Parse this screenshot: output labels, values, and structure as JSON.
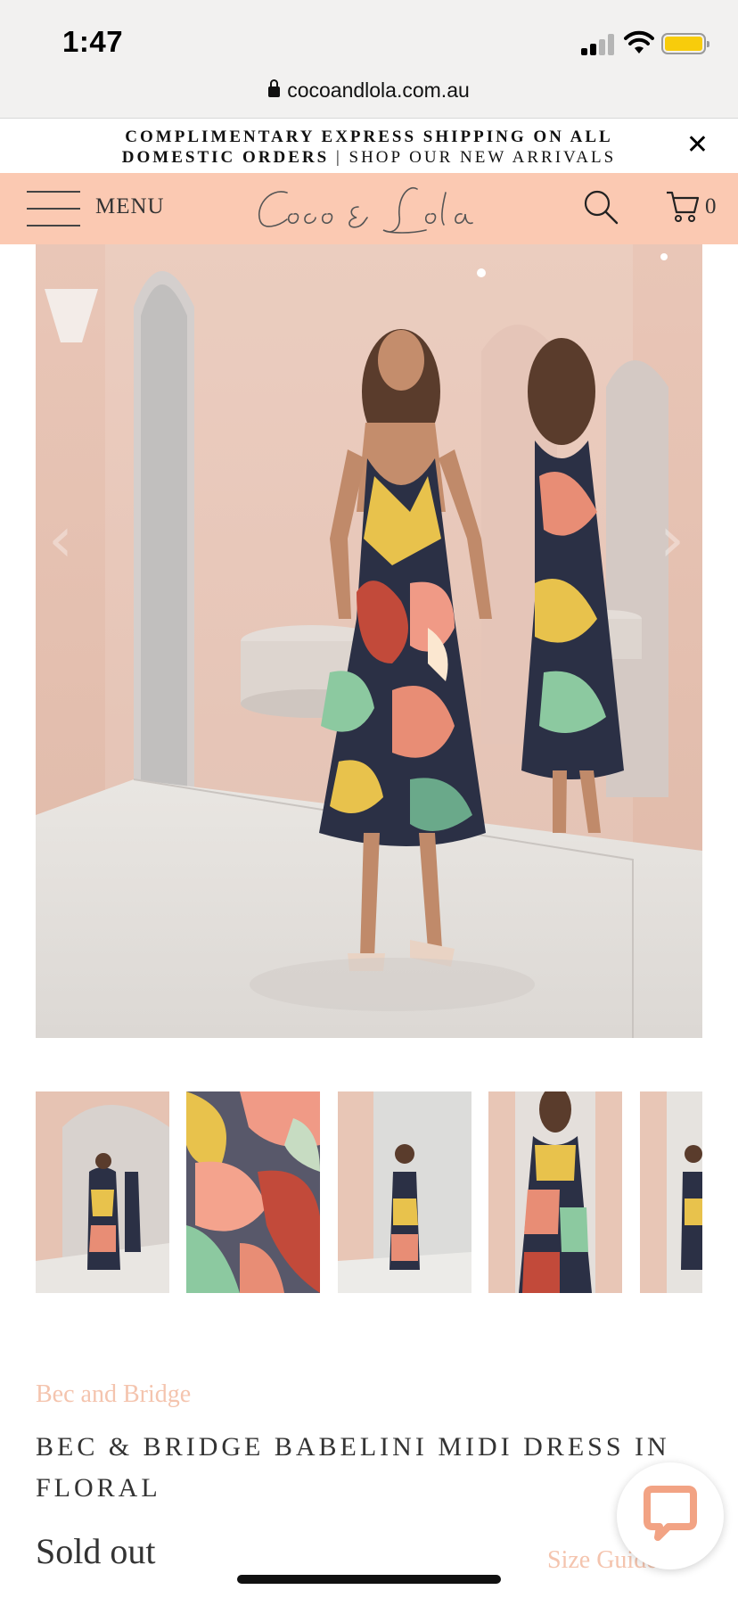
{
  "status_bar": {
    "time": "1:47"
  },
  "browser": {
    "url": "cocoandlola.com.au"
  },
  "announcement": {
    "line1": "COMPLIMENTARY EXPRESS SHIPPING ON ALL",
    "line2_bold": "DOMESTIC ORDERS",
    "separator": " | ",
    "line2_link": "SHOP OUR NEW ARRIVALS",
    "close": "✕"
  },
  "header": {
    "menu_label": "MENU",
    "logo_text": "Coco & Lola",
    "cart_count": "0"
  },
  "gallery": {
    "prev": "‹",
    "next": "›",
    "thumbnail_count": 5
  },
  "product": {
    "brand": "Bec and Bridge",
    "title": "BEC & BRIDGE BABELINI MIDI DRESS IN FLORAL",
    "status": "Sold out",
    "size_guide": "Size Guide ›"
  },
  "colors": {
    "header_bg": "#fbc9b2",
    "accent": "#f4c4ae",
    "text": "#333333"
  },
  "icons": [
    "lock-icon",
    "close-icon",
    "hamburger-icon",
    "search-icon",
    "cart-icon",
    "chat-icon"
  ]
}
